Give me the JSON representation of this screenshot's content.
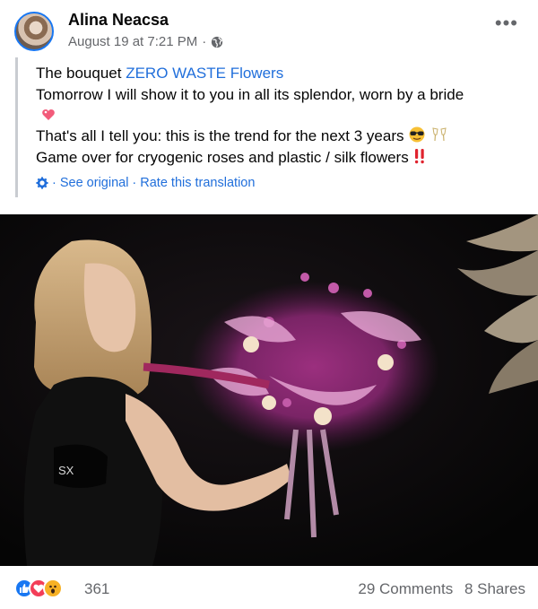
{
  "post": {
    "author": "Alina Neacsa",
    "timestamp": "August 19 at 7:21 PM",
    "separator": "·",
    "privacy_icon": "globe-icon",
    "more_label": "•••"
  },
  "text": {
    "line1_prefix": "The bouquet ",
    "line1_link": "ZERO WASTE Flowers",
    "line2": "Tomorrow I will show it to you in all its splendor, worn by a bride",
    "line3": "That's all I tell you: this is the trend for the next 3 years",
    "line4": "Game over for cryogenic roses and plastic / silk flowers"
  },
  "translation": {
    "icon": "gear-icon",
    "see_original": "See original",
    "separator": "·",
    "rate": "Rate this translation"
  },
  "photo": {
    "shirt_print": "SX"
  },
  "engagement": {
    "reaction_icons": [
      "like-icon",
      "love-icon",
      "wow-icon"
    ],
    "reaction_count": "361",
    "comments": "29 Comments",
    "shares": "8 Shares"
  },
  "colors": {
    "link": "#216fdb",
    "like": "#1877f2",
    "love": "#f33e58",
    "wow": "#f7b125"
  }
}
